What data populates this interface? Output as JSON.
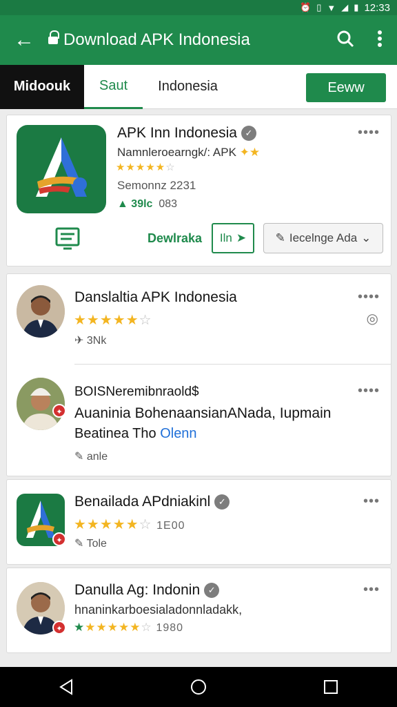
{
  "status_bar": {
    "time": "12:33",
    "icons": [
      "alarm-icon",
      "vibrate-icon",
      "wifi-icon",
      "signal-icon",
      "battery-icon"
    ]
  },
  "toolbar": {
    "title": "Download APK Indonesia",
    "back_icon": "back-arrow-icon",
    "search_icon": "search-icon",
    "menu_icon": "more-vert-icon"
  },
  "tabs": {
    "dark_label": "Midoouk",
    "items": [
      {
        "label": "Saut"
      },
      {
        "label": "Indonesia"
      }
    ],
    "button_label": "Eeww"
  },
  "featured": {
    "name": "APK Inn Indonesia",
    "developer": "Namnleroearngk/: APK",
    "rating": 4.5,
    "subtitle": "Semonnz 2231",
    "downloads": "39lc",
    "size": "083",
    "download_label": "Dewlraka",
    "install_label": "Iln",
    "dropdown_label": "Iecelnge Ada",
    "colors": {
      "accent": "#1f8a4c",
      "icon_bg": "#1b7a43"
    }
  },
  "list": [
    {
      "name": "Danslaltia APK Indonesia",
      "rating": 4.5,
      "meta": "3Nk",
      "type": "avatar"
    },
    {
      "name": "BOISNeremibnraold$",
      "line2": "Auaninia BohenaansianANada, Iupmain",
      "line3_text": "Beatinea Tho",
      "line3_link": "Olenn",
      "meta": "anle",
      "type": "avatar-cap"
    },
    {
      "name": "Benailada APdniakinl",
      "rating": 4.5,
      "rating_count": "1E00",
      "meta": "Tole",
      "type": "app"
    },
    {
      "name": "Danulla Ag: Indonin",
      "line2": "hnaninkarboesialadonnladakk,",
      "rating": 4.5,
      "rating_count": "1980",
      "type": "avatar"
    }
  ]
}
